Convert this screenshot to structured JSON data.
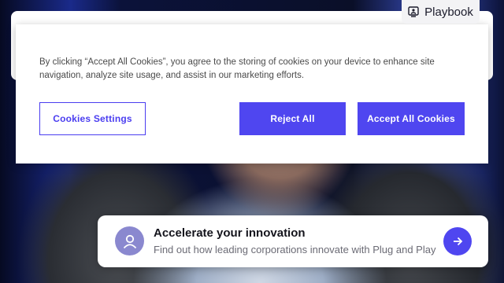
{
  "nav": {
    "playbook_label": "Playbook",
    "playbook_icon": "presentation-icon"
  },
  "cookie_banner": {
    "text": "By clicking “Accept All Cookies”, you agree to the storing of cookies on your device to enhance site navigation, analyze site usage, and assist in our marketing efforts.",
    "settings_label": "Cookies Settings",
    "reject_label": "Reject All",
    "accept_label": "Accept All Cookies",
    "accent_color": "#4f46f0"
  },
  "promo_card": {
    "title": "Accelerate your innovation",
    "subtitle": "Find out how leading corporations innovate with Plug and Play",
    "avatar_icon": "user-icon",
    "arrow_icon": "arrow-right-icon"
  }
}
